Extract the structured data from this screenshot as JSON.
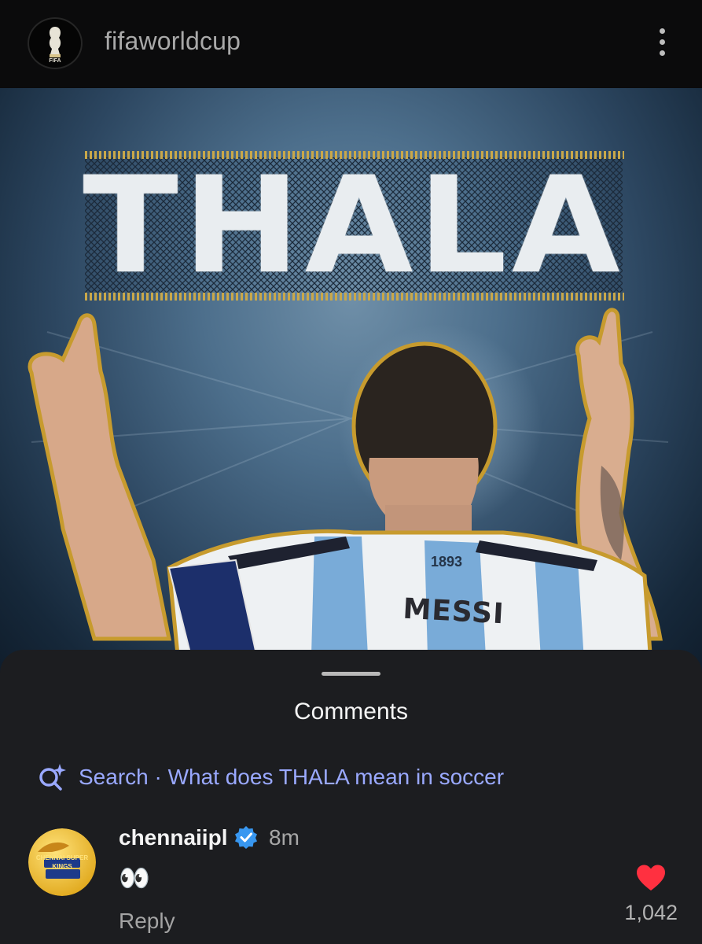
{
  "header": {
    "username": "fifaworldcup",
    "avatar_text": "FIFA"
  },
  "post": {
    "title": "THALA",
    "jersey_name": "MESSI",
    "jersey_year": "1893"
  },
  "comments_sheet": {
    "title": "Comments",
    "search_prefix": "Search",
    "search_query": "What does THALA mean in soccer",
    "search_text": "Search · What does THALA mean in soccer",
    "comments": [
      {
        "username": "chennaiipl",
        "verified": true,
        "time": "8m",
        "text": "👀",
        "reply_label": "Reply",
        "like_count": "1,042",
        "avatar_text": "CHENNAI SUPER KINGS"
      }
    ]
  },
  "colors": {
    "background": "#0d0d0f",
    "sheet": "#1c1d20",
    "search_accent": "#9aa9ff",
    "verified": "#3897f0",
    "like": "#ff3040"
  },
  "icons": {
    "more": "more-vertical-icon",
    "search": "sparkle-search-icon",
    "verified": "verified-badge-icon",
    "like": "heart-filled-icon"
  }
}
